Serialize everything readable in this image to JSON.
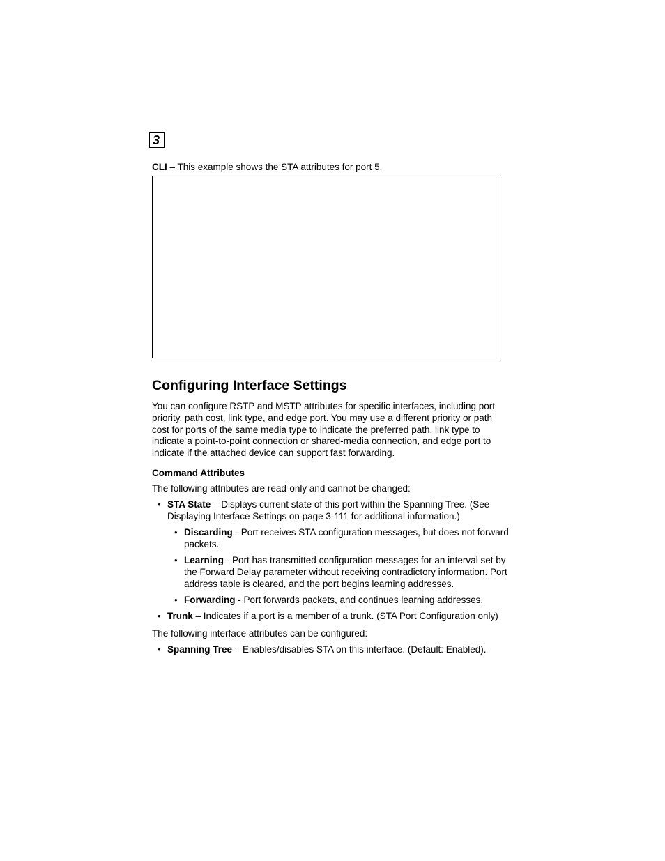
{
  "chapter_number": "3",
  "intro": {
    "lead": "CLI",
    "rest": " – This example shows the STA attributes for port 5."
  },
  "section_title": "Configuring Interface Settings",
  "para_intro": "You can configure RSTP and MSTP attributes for specific interfaces, including port priority, path cost, link type, and edge port. You may use a different priority or path cost for ports of the same media type to indicate the preferred path, link type to indicate a point-to-point connection or shared-media connection, and edge port to indicate if the attached device can support fast forwarding.",
  "command_attr_heading": "Command Attributes",
  "readonly_intro": "The following attributes are read-only and cannot be changed:",
  "readonly_items": [
    {
      "lead": "STA State",
      "rest": " – Displays current state of this port within the Spanning Tree. (See Displaying Interface Settings on page 3-111 for additional information.)",
      "children": [
        {
          "lead": "Discarding",
          "rest": " - Port receives STA configuration messages, but does not forward packets."
        },
        {
          "lead": "Learning",
          "rest": " - Port has transmitted configuration messages for an interval set by the Forward Delay parameter without receiving contradictory information. Port address table is cleared, and the port begins learning addresses."
        },
        {
          "lead": "Forwarding",
          "rest": " - Port forwards packets, and continues learning addresses."
        }
      ]
    },
    {
      "lead": "Trunk",
      "rest": " – Indicates if a port is a member of a trunk. (STA Port Configuration only)"
    }
  ],
  "config_intro": "The following interface attributes can be configured:",
  "config_items": [
    {
      "lead": "Spanning Tree",
      "rest": " – Enables/disables STA on this interface. (Default: Enabled)."
    }
  ]
}
